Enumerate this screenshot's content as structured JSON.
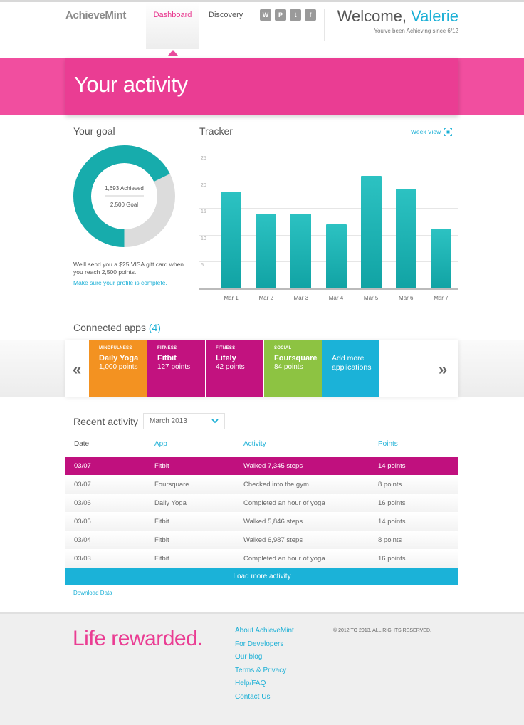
{
  "header": {
    "logo": "AchieveMint",
    "nav": [
      "Dashboard",
      "Discovery"
    ],
    "social_icons": [
      "wordpress-icon",
      "pinterest-icon",
      "twitter-icon",
      "facebook-icon"
    ],
    "welcome_prefix": "Welcome, ",
    "user_name": "Valerie",
    "since": "You've been Achieving since 6/12"
  },
  "banner": {
    "title": "Your activity"
  },
  "goal": {
    "heading": "Your goal",
    "achieved_label": "1,693 Achieved",
    "goal_label": "2,500 Goal",
    "achieved": 1693,
    "goal": 2500,
    "note": "We'll send you a $25 VISA gift card when you reach 2,500 points.",
    "link": "Make sure your profile is complete."
  },
  "tracker": {
    "heading": "Tracker",
    "week_view": "Week View"
  },
  "chart_data": {
    "type": "bar",
    "categories": [
      "Mar 1",
      "Mar 2",
      "Mar 3",
      "Mar 4",
      "Mar 5",
      "Mar 6",
      "Mar 7"
    ],
    "values": [
      18,
      13.8,
      14,
      12,
      21,
      18.6,
      11
    ],
    "yticks": [
      5,
      10,
      15,
      20,
      25
    ],
    "ylim": [
      0,
      25
    ],
    "grid": true,
    "color": "#1bb0b0"
  },
  "apps": {
    "heading": "Connected apps",
    "count": "(4)",
    "prev": "«",
    "next": "»",
    "tiles": [
      {
        "category": "MINDFULNESS",
        "name": "Daily Yoga",
        "points": "1,000 points",
        "color": "#f39221"
      },
      {
        "category": "FITNESS",
        "name": "Fitbit",
        "points": "127 points",
        "color": "#c2127f"
      },
      {
        "category": "FITNESS",
        "name": "Lifely",
        "points": "42 points",
        "color": "#c2127f"
      },
      {
        "category": "SOCIAL",
        "name": "Foursquare",
        "points": "84 points",
        "color": "#8dc342"
      }
    ],
    "add_more": "Add more applications",
    "add_color": "#1bb2d8"
  },
  "recent": {
    "heading": "Recent activity",
    "month": "March 2013",
    "columns": [
      "Date",
      "App",
      "Activity",
      "Points"
    ],
    "rows": [
      {
        "date": "03/07",
        "app": "Fitbit",
        "activity": "Walked 7,345 steps",
        "points": "14 points"
      },
      {
        "date": "03/07",
        "app": "Foursquare",
        "activity": "Checked into the gym",
        "points": "8 points"
      },
      {
        "date": "03/06",
        "app": "Daily Yoga",
        "activity": "Completed an hour of yoga",
        "points": "16 points"
      },
      {
        "date": "03/05",
        "app": "Fitbit",
        "activity": "Walked 5,846 steps",
        "points": "14 points"
      },
      {
        "date": "03/04",
        "app": "Fitbit",
        "activity": "Walked 6,987 steps",
        "points": "8 points"
      },
      {
        "date": "03/03",
        "app": "Fitbit",
        "activity": "Completed an hour of yoga",
        "points": "16 points"
      }
    ],
    "load_more": "Load more activity",
    "download": "Download Data"
  },
  "footer": {
    "tagline": "Life rewarded.",
    "links": [
      "About AchieveMint",
      "For Developers",
      "Our blog",
      "Terms & Privacy",
      "Help/FAQ",
      "Contact Us"
    ],
    "copyright": "© 2012 TO 2013. ALL RIGHTS RESERVED."
  },
  "colors": {
    "pink": "#ea3d93",
    "teal": "#1bb0b0",
    "blue": "#1bb2d8",
    "magenta": "#c0107e"
  }
}
